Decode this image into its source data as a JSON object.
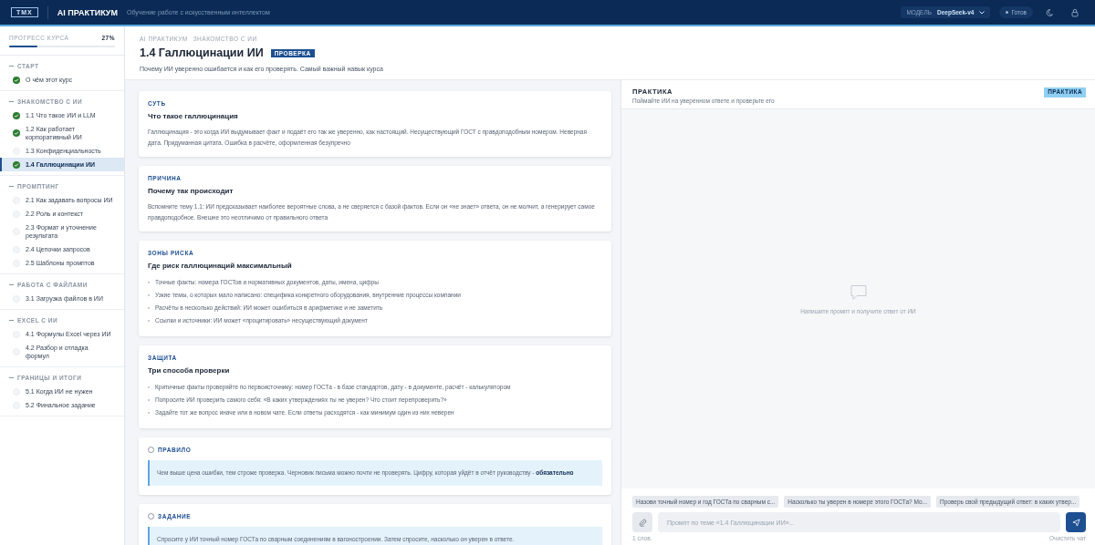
{
  "header": {
    "logo": "ТМХ",
    "title": "AI ПРАКТИКУМ",
    "subtitle": "Обучение работе с искусственным интеллектом",
    "model_label": "МОДЕЛЬ",
    "model_value": "DeepSeek-v4",
    "status": "Готов"
  },
  "sidebar": {
    "progress_label": "ПРОГРЕСС КУРСА",
    "progress_value": "27%",
    "level": 0.27,
    "sections": [
      {
        "title": "СТАРТ",
        "items": [
          {
            "label": "О чём этот курс",
            "done": true,
            "selected": false
          }
        ]
      },
      {
        "title": "ЗНАКОМСТВО С ИИ",
        "items": [
          {
            "label": "1.1 Что такое ИИ и LLM",
            "done": true,
            "selected": false
          },
          {
            "label": "1.2 Как работает корпоративный ИИ",
            "done": true,
            "selected": false
          },
          {
            "label": "1.3 Конфиденциальность",
            "done": false,
            "selected": false
          },
          {
            "label": "1.4 Галлюцинации ИИ",
            "done": true,
            "selected": true
          }
        ]
      },
      {
        "title": "ПРОМПТИНГ",
        "items": [
          {
            "label": "2.1 Как задавать вопросы ИИ",
            "done": false,
            "selected": false
          },
          {
            "label": "2.2 Роль и контекст",
            "done": false,
            "selected": false
          },
          {
            "label": "2.3 Формат и уточнение результата",
            "done": false,
            "selected": false
          },
          {
            "label": "2.4 Цепочки запросов",
            "done": false,
            "selected": false
          },
          {
            "label": "2.5 Шаблоны промптов",
            "done": false,
            "selected": false
          }
        ]
      },
      {
        "title": "РАБОТА С ФАЙЛАМИ",
        "items": [
          {
            "label": "3.1 Загрузка файлов в ИИ",
            "done": false,
            "selected": false
          }
        ]
      },
      {
        "title": "EXCEL С ИИ",
        "items": [
          {
            "label": "4.1 Формулы Excel через ИИ",
            "done": false,
            "selected": false
          },
          {
            "label": "4.2 Разбор и отладка формул",
            "done": false,
            "selected": false
          }
        ]
      },
      {
        "title": "ГРАНИЦЫ И ИТОГИ",
        "items": [
          {
            "label": "5.1 Когда ИИ не нужен",
            "done": false,
            "selected": false
          },
          {
            "label": "5.2 Финальное задание",
            "done": false,
            "selected": false
          }
        ]
      }
    ]
  },
  "page": {
    "breadcrumb": [
      "AI ПРАКТИКУМ",
      "ЗНАКОМСТВО С ИИ"
    ],
    "title": "1.4 Галлюцинации ИИ",
    "badge": "ПРОВЕРКА",
    "subtitle": "Почему ИИ уверенно ошибается и как его проверять. Самый важный навык курса"
  },
  "cards": [
    {
      "kind": "text",
      "label": "СУТЬ",
      "title": "Что такое галлюцинация",
      "text": "Галлюцинация - это когда ИИ выдумывает факт и подаёт его так же уверенно, как настоящий. Несуществующий ГОСТ с правдоподобным номером. Неверная дата. Придуманная цитата. Ошибка в расчёте, оформленная безупречно"
    },
    {
      "kind": "text",
      "label": "ПРИЧИНА",
      "title": "Почему так происходит",
      "text": "Вспомните тему 1.1: ИИ предсказывает наиболее вероятные слова, а не сверяется с базой фактов. Если он «не знает» ответа, он не молчит, а генерирует самое правдоподобное. Внешне это неотличимо от правильного ответа"
    },
    {
      "kind": "list",
      "label": "ЗОНЫ РИСКА",
      "title": "Где риск галлюцинаций максимальный",
      "items": [
        "Точные факты: номера ГОСТов и нормативных документов, даты, имена, цифры",
        "Узкие темы, о которых мало написано: специфика конкретного оборудования, внутренние процессы компании",
        "Расчёты в несколько действий: ИИ может ошибиться в арифметике и не заметить",
        "Ссылки и источники: ИИ может «процитировать» несуществующий документ"
      ]
    },
    {
      "kind": "list",
      "label": "ЗАЩИТА",
      "title": "Три способа проверки",
      "items": [
        "Критичные факты проверяйте по первоисточнику: номер ГОСТа - в базе стандартов, дату - в документе, расчёт - калькулятором",
        "Попросите ИИ проверить самого себя: «В каких утверждениях ты не уверен? Что стоит перепроверить?»",
        "Задайте тот же вопрос иначе или в новом чате. Если ответы расходятся - как минимум один из них неверен"
      ]
    },
    {
      "kind": "callout",
      "label": "ПРАВИЛО",
      "text": "Чем выше цена ошибки, тем строже проверка. Черновик письма можно почти не проверять. Цифру, которая уйдёт в отчёт руководству - **обязательно**"
    },
    {
      "kind": "callout",
      "label": "ЗАДАНИЕ",
      "text": "Спросите у ИИ точный номер ГОСТа по сварным соединениям в вагоностроении. Затем спросите, насколько он уверен в ответе."
    }
  ],
  "practice": {
    "title": "ПРАКТИКА",
    "subtitle": "Поймайте ИИ на уверенном ответе и проверьте его",
    "badge": "ПРАКТИКА",
    "empty": "Напишите промпт и получите ответ от ИИ",
    "chips": [
      "Назови точный номер и год ГОСТа по сварным с...",
      "Насколько ты уверен в номере этого ГОСТа? Мо...",
      "Проверь свой предыдущий ответ: в каких утвер..."
    ],
    "placeholder": "Промпт по теме «1.4 Галлюцинации ИИ»...",
    "counter": "1 слов.",
    "clear": "Очистить чат"
  }
}
